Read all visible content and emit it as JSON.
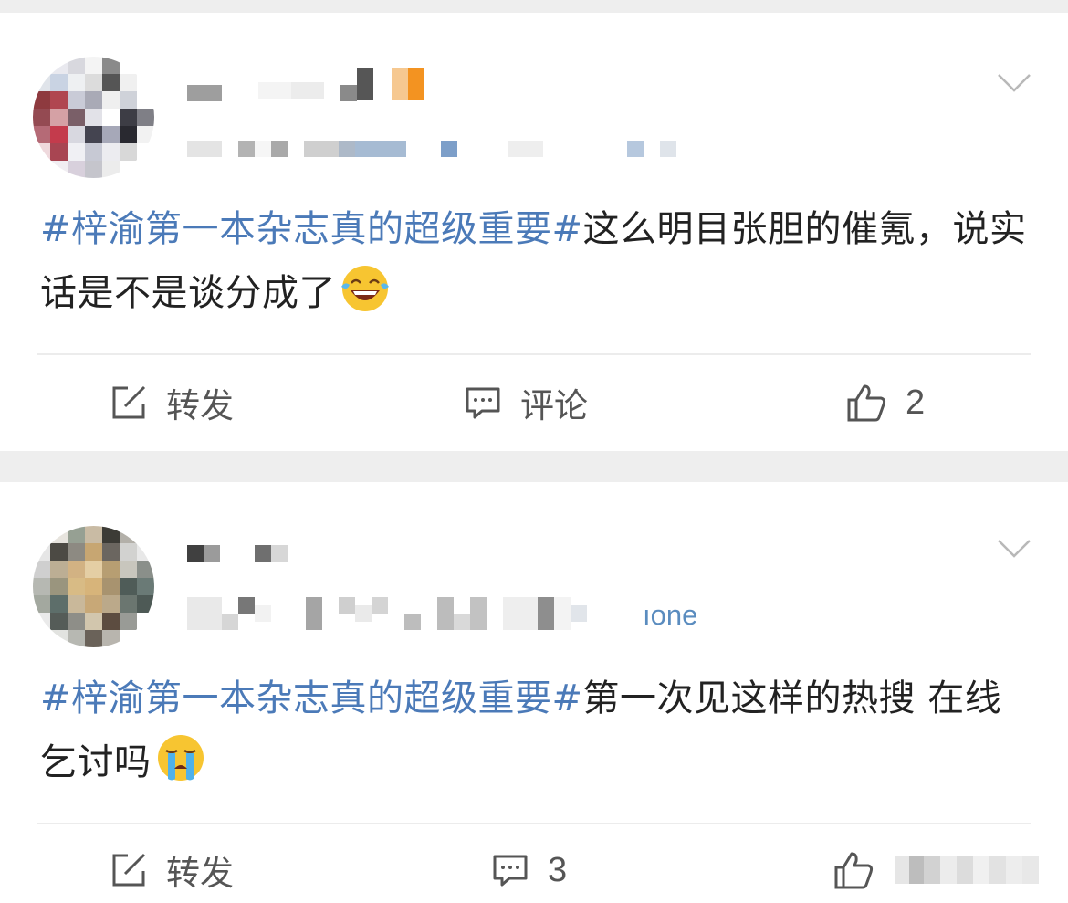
{
  "colors": {
    "background": "#eeeeee",
    "card": "#ffffff",
    "hashtag": "#4b7ab8",
    "text": "#222222",
    "action_text": "#555555"
  },
  "posts": [
    {
      "hashtag": "#梓渝第一本杂志真的超级重要#",
      "body": "这么明目张胆的催氪，说实话是不是谈分成了",
      "emoji": "laughing-tears-emoji",
      "actions": {
        "repost_label": "转发",
        "comment_label": "评论",
        "like_count": "2"
      }
    },
    {
      "source_suffix": "ıone",
      "hashtag": "#梓渝第一本杂志真的超级重要#",
      "body": "第一次见这样的热搜 在线乞讨吗",
      "emoji": "crying-emoji",
      "actions": {
        "repost_label": "转发",
        "comment_count": "3",
        "like_count": ""
      }
    }
  ]
}
